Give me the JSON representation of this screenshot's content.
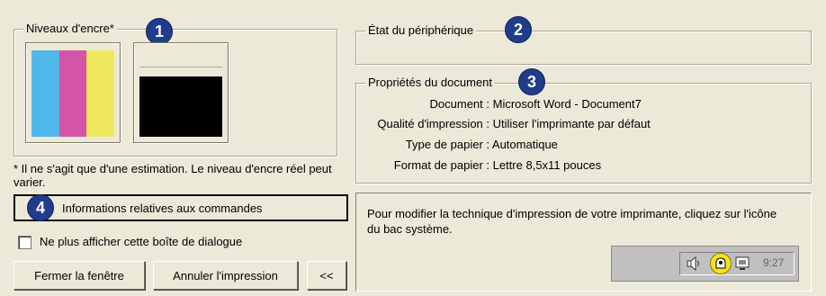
{
  "ink": {
    "label": "Niveaux d'encre*",
    "badge": "1",
    "note": "* Il ne s'agit que d'une estimation. Le niveau d'encre réel peut varier.",
    "color_cartridge": {
      "colors": [
        "#4fb8e8",
        "#d454a8",
        "#f2e860"
      ],
      "level": 1.0
    },
    "black_cartridge": {
      "color": "#000000",
      "level": 0.7
    }
  },
  "order_info": {
    "badge": "4",
    "label": "Informations relatives aux commandes"
  },
  "dont_show": {
    "label": "Ne plus afficher cette boîte de dialogue",
    "checked": false
  },
  "buttons": {
    "close": "Fermer la fenêtre",
    "cancel": "Annuler l'impression",
    "collapse": "<<"
  },
  "device_status": {
    "label": "État du périphérique",
    "badge": "2"
  },
  "doc_props": {
    "label": "Propriétés du document",
    "badge": "3",
    "rows": [
      {
        "key": "Document :",
        "value": "Microsoft Word - Document7"
      },
      {
        "key": "Qualité d'impression :",
        "value": "Utiliser l'imprimante par défaut"
      },
      {
        "key": "Type de papier :",
        "value": "Automatique"
      },
      {
        "key": "Format de papier :",
        "value": "Lettre 8,5x11 pouces"
      }
    ]
  },
  "tip": {
    "text": "Pour modifier la technique d'impression de votre imprimante, cliquez sur l'icône du bac système.",
    "clock": "9:27",
    "icons": [
      "speaker-icon",
      "printer-tray-icon",
      "monitor-icon"
    ]
  }
}
